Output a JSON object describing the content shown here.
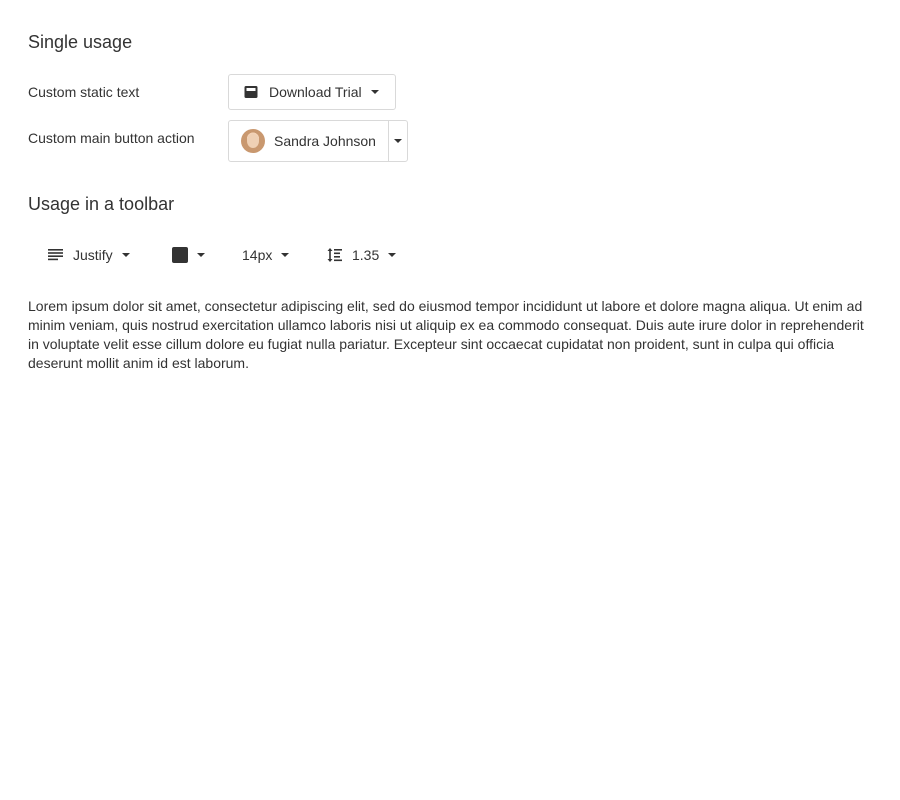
{
  "single_usage": {
    "title": "Single usage",
    "static_text_row": {
      "label": "Custom static text",
      "button_label": "Download Trial",
      "icon": "window-icon"
    },
    "main_action_row": {
      "label": "Custom main button action",
      "button_label": "Sandra Johnson",
      "icon": "avatar"
    }
  },
  "toolbar": {
    "title": "Usage in a toolbar",
    "align": {
      "label": "Justify",
      "icon": "justify-icon"
    },
    "color": {
      "swatch_color": "#333333"
    },
    "font_size": {
      "label": "14px"
    },
    "line_height": {
      "label": "1.35",
      "icon": "line-height-icon"
    }
  },
  "paragraph": "Lorem ipsum dolor sit amet, consectetur adipiscing elit, sed do eiusmod tempor incididunt ut labore et dolore magna aliqua. Ut enim ad minim veniam, quis nostrud exercitation ullamco laboris nisi ut aliquip ex ea commodo consequat. Duis aute irure dolor in reprehenderit in voluptate velit esse cillum dolore eu fugiat nulla pariatur. Excepteur sint occaecat cupidatat non proident, sunt in culpa qui officia deserunt mollit anim id est laborum."
}
